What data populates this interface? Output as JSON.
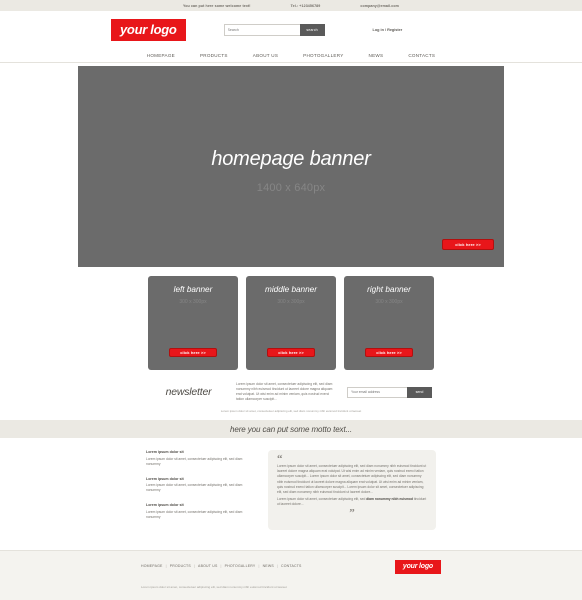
{
  "colors": {
    "accent": "#e8161a",
    "strip": "#ebe9e3",
    "banner_gray": "#6b6b6b",
    "btn_dark": "#5a5a5a"
  },
  "topbar": {
    "welcome": "You can put here some welcome text!",
    "phone": "Tel.: +123456789",
    "email": "company@email.com"
  },
  "header": {
    "logo": "your logo",
    "search_placeholder": "Search",
    "search_value": "",
    "search_button": "search",
    "account_links": "Log in / Register"
  },
  "nav": {
    "items": [
      {
        "label": "HOMEPAGE"
      },
      {
        "label": "PRODUCTS"
      },
      {
        "label": "ABOUT US"
      },
      {
        "label": "PHOTOGALLERY"
      },
      {
        "label": "NEWS"
      },
      {
        "label": "CONTACTS"
      }
    ]
  },
  "banner": {
    "title": "homepage banner",
    "size": "1400 x 640px",
    "cta": "click here >>"
  },
  "promos": [
    {
      "title": "left banner",
      "size": "300 x 300px",
      "cta": "click here >>"
    },
    {
      "title": "middle banner",
      "size": "300 x 300px",
      "cta": "click here >>"
    },
    {
      "title": "right banner",
      "size": "300 x 300px",
      "cta": "click here >>"
    }
  ],
  "newsletter": {
    "title": "newsletter",
    "description": "Lorem ipsum dolor sit amet, consectetuer adipiscing elit, sed diam nonummy nibh euismod tincidunt ut laoreet dolore magna aliquam erat volutpat. Ut wisi enim ad minim veniam, quis nostrud exerci tation ullamcorper suscipit...",
    "email_placeholder": "Your email address",
    "email_value": "",
    "send_button": "send",
    "fine_print": "Lorem ipsum dolor sit amet, consectetuer adipiscing elit, sed diam nonummy nibh euismod tincidunt ut laoreet"
  },
  "motto": {
    "text": "here you can put some motto text..."
  },
  "news": {
    "items": [
      {
        "heading": "Lorem ipsum dolor sit",
        "body": "Lorem ipsum dolor sit amet, consectetuer adipiscing elit, sed diam nonummy"
      },
      {
        "heading": "Lorem ipsum dolor sit",
        "body": "Lorem ipsum dolor sit amet, consectetuer adipiscing elit, sed diam nonummy"
      },
      {
        "heading": "Lorem ipsum dolor sit",
        "body": "Lorem ipsum dolor sit amet, consectetuer adipiscing elit, sed diam nonummy"
      }
    ]
  },
  "quote": {
    "open_mark": "“",
    "close_mark": "”",
    "paragraph_1": "Lorem ipsum dolor sit amet, consectetuer adipiscing elit, sed diam nonummy nibh euismod tincidunt ut laoreet dolore magna aliquam erat volutpat. Ut wisi enim ad minim veniam, quis nostrud exerci tation ullamcorper suscipit... Lorem ipsum dolor sit amet, consectetuer adipiscing elit, sed diam nonummy nibh euismod tincidunt ut laoreet dolore magna aliquam erat volutpat. Ut wisi enim ad minim veniam, quis nostrud exerci tation ullamcorper suscipit... Lorem ipsum dolor sit amet, consectetuer adipiscing elit, sed diam nonummy nibh euismod tincidunt ut laoreet dolore...",
    "bold_1": "euismod tincidunt ut laoreet dolore",
    "bold_2": "euismod tincidunt ut laoreet dolore",
    "bold_3": "Lorem ipsum dolor sit amet,",
    "paragraph_2": "Lorem ipsum dolor sit amet, consectetuer adipiscing elit, sed ",
    "bold_4": "diam nonummy nibh euismod",
    "paragraph_2_tail": " tincidunt ut laoreet dolore..."
  },
  "footer": {
    "nav": [
      {
        "label": "HOMEPAGE"
      },
      {
        "label": "PRODUCTS"
      },
      {
        "label": "ABOUT US"
      },
      {
        "label": "PHOTOGALLERY"
      },
      {
        "label": "NEWS"
      },
      {
        "label": "CONTACTS"
      }
    ],
    "separator": "|",
    "logo": "your logo",
    "copyright": "Lorem ipsum dolor sit amet, consectetuer adipiscing elit, sed diam nonummy nibh euismod tincidunt ut laoreet"
  }
}
